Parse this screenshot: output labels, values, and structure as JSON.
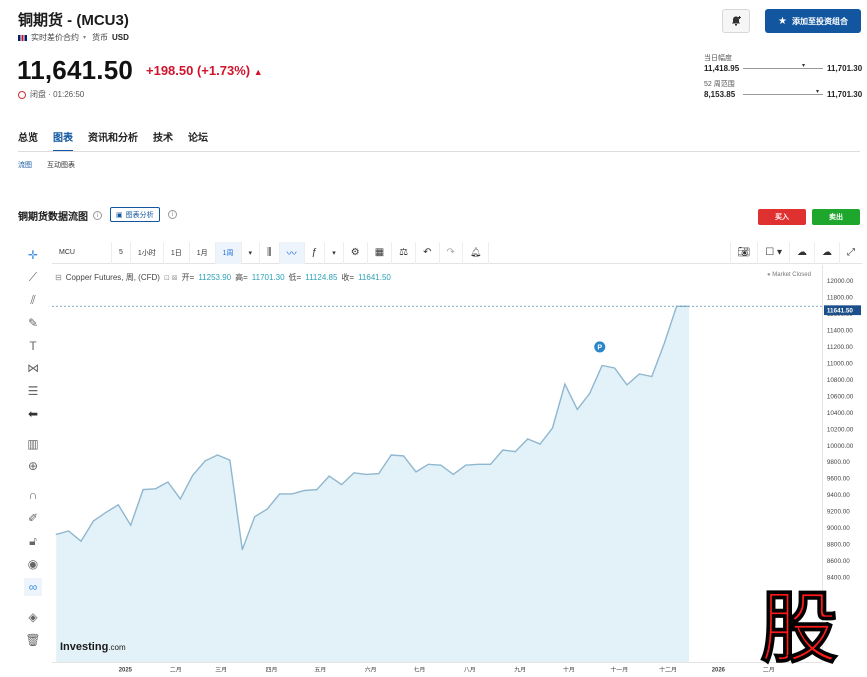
{
  "header": {
    "title": "铜期货 - (MCU3)",
    "contract_type": "实时差价合约",
    "currency_label": "货币",
    "currency": "USD",
    "price": "11,641.50",
    "change": "+198.50 (+1.73%)",
    "status": "闭盘 · 01:26:50",
    "watchlist_button": "添加至投资组合"
  },
  "ranges": {
    "day_label": "当日幅度",
    "day_low": "11,418.95",
    "day_high": "11,701.30",
    "week52_label": "52 周范围",
    "week52_low": "8,153.85",
    "week52_high": "11,701.30"
  },
  "tabs": [
    "总览",
    "图表",
    "资讯和分析",
    "技术",
    "论坛"
  ],
  "subtabs": [
    "流图",
    "互动图表"
  ],
  "section": {
    "title": "铜期货数据流图",
    "analysis_button": "图表分析",
    "buy": "买入",
    "sell": "卖出"
  },
  "toolbar": {
    "symbol": "MCU",
    "intervals": [
      "5",
      "1小时",
      "1日",
      "1月",
      "1周"
    ],
    "selected_interval": "1周"
  },
  "legend": {
    "name": "Copper Futures, 周, (CFD)",
    "open_label": "开=",
    "open": "11253.90",
    "high_label": "高=",
    "high": "11701.30",
    "low_label": "低=",
    "low": "11124.85",
    "close_label": "收=",
    "close": "11641.50",
    "market_status": "Market Closed",
    "marker": "P"
  },
  "logo": {
    "main": "Investing",
    "suffix": ".com"
  },
  "stamp_char": "股",
  "colors": {
    "accent": "#1256a0",
    "down": "#d0142c",
    "buy": "#e03131",
    "sell": "#1fa62c",
    "line": "#8fb7cf",
    "fill": "#e3f1f9"
  },
  "chart_data": {
    "type": "area",
    "title": "",
    "series": [
      {
        "name": "",
        "x": [
          "2024-12-09",
          "2024-12-16",
          "2024-12-23",
          "2024-12-30",
          "2025-01-06",
          "2025-01-13",
          "2025-01-20",
          "2025-01-27",
          "2025-02-03",
          "2025-02-10",
          "2025-02-17",
          "2025-02-24",
          "2025-03-03",
          "2025-03-10",
          "2025-03-17",
          "2025-03-24",
          "2025-03-31",
          "2025-04-07",
          "2025-04-14",
          "2025-04-21",
          "2025-04-28",
          "2025-05-05",
          "2025-05-12",
          "2025-05-19",
          "2025-05-26",
          "2025-06-02",
          "2025-06-09",
          "2025-06-16",
          "2025-06-23",
          "2025-06-30",
          "2025-07-07",
          "2025-07-14",
          "2025-07-21",
          "2025-07-28",
          "2025-08-04",
          "2025-08-11",
          "2025-08-18",
          "2025-08-25",
          "2025-09-01",
          "2025-09-08",
          "2025-09-15",
          "2025-09-22",
          "2025-09-29",
          "2025-10-06",
          "2025-10-13",
          "2025-10-20",
          "2025-10-27",
          "2025-11-03",
          "2025-11-10",
          "2025-11-17",
          "2025-11-24",
          "2025-12-01"
        ],
        "values": [
          8940,
          8980,
          8860,
          9100,
          9200,
          9290,
          9050,
          9470,
          9480,
          9560,
          9360,
          9640,
          9810,
          9880,
          9820,
          8760,
          9150,
          9240,
          9420,
          9420,
          9460,
          9470,
          9630,
          9530,
          9670,
          9650,
          9660,
          9880,
          9870,
          9680,
          9770,
          9760,
          9650,
          9760,
          9770,
          9770,
          9940,
          9920,
          10070,
          10010,
          10200,
          10720,
          10420,
          10610,
          10940,
          10910,
          10710,
          10840,
          10810,
          11200,
          11641.5,
          11641.5
        ]
      }
    ],
    "xaxis_labels": [
      "2025",
      "二月",
      "三月",
      "四月",
      "五月",
      "六月",
      "七月",
      "八月",
      "九月",
      "十月",
      "十一月",
      "十二月",
      "2026",
      "二月"
    ],
    "yaxis_labels": [
      "12000.00",
      "11800.00",
      "11600.00",
      "11400.00",
      "11200.00",
      "11000.00",
      "10800.00",
      "10600.00",
      "10400.00",
      "10200.00",
      "10000.00",
      "9800.00",
      "9600.00",
      "9400.00",
      "9200.00",
      "9000.00",
      "8800.00",
      "8600.00",
      "8400.00"
    ],
    "last_price_label": "11641.50",
    "ylim": [
      8400,
      12000
    ],
    "grid": false
  }
}
